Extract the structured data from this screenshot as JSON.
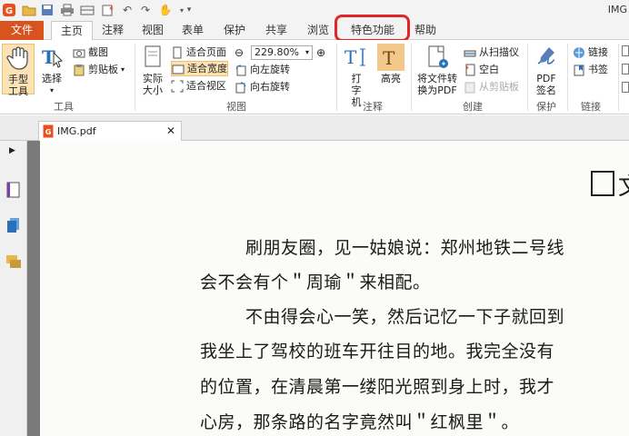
{
  "window": {
    "title": "IMG"
  },
  "menu": {
    "tabs": [
      "文件",
      "主页",
      "注释",
      "视图",
      "表单",
      "保护",
      "共享",
      "浏览",
      "特色功能",
      "帮助"
    ],
    "active": "主页",
    "highlighted": "特色功能"
  },
  "ribbon": {
    "tools": {
      "hand": "手型工具",
      "select": "选择",
      "screenshot": "截图",
      "clipboard": "剪贴板",
      "label": "工具"
    },
    "view": {
      "actual_size": "实际大小",
      "fit_page": "适合页面",
      "fit_width": "适合宽度",
      "fit_visible": "适合视区",
      "zoom": "229.80%",
      "rotate_left": "向左旋转",
      "rotate_right": "向右旋转",
      "label": "视图"
    },
    "comment": {
      "typewriter": "打字机",
      "highlight": "高亮",
      "label": "注释"
    },
    "create": {
      "convert": "将文件转换为PDF",
      "from_scanner": "从扫描仪",
      "blank": "空白",
      "from_clipboard": "从剪贴板",
      "label": "创建"
    },
    "protect": {
      "sign": "PDF签名",
      "label": "保护"
    },
    "links": {
      "link": "链接",
      "bookmark": "书签",
      "label": "链接"
    }
  },
  "document_tab": {
    "name": "IMG.pdf"
  },
  "document": {
    "heading_char": "文",
    "lines": [
      "刷朋友圈，见一姑娘说：郑州地铁二号线",
      "会不会有个＂周瑜＂来相配。",
      "不由得会心一笑，然后记忆一下子就回到",
      "我坐上了驾校的班车开往目的地。我完全没有",
      "的位置，在清晨第一缕阳光照到身上时，我才",
      "心房，那条路的名字竟然叫＂红枫里＂。"
    ]
  },
  "colors": {
    "accent": "#d9531e",
    "highlight_oval": "#e0262a",
    "selected": "#fbe3b6"
  }
}
